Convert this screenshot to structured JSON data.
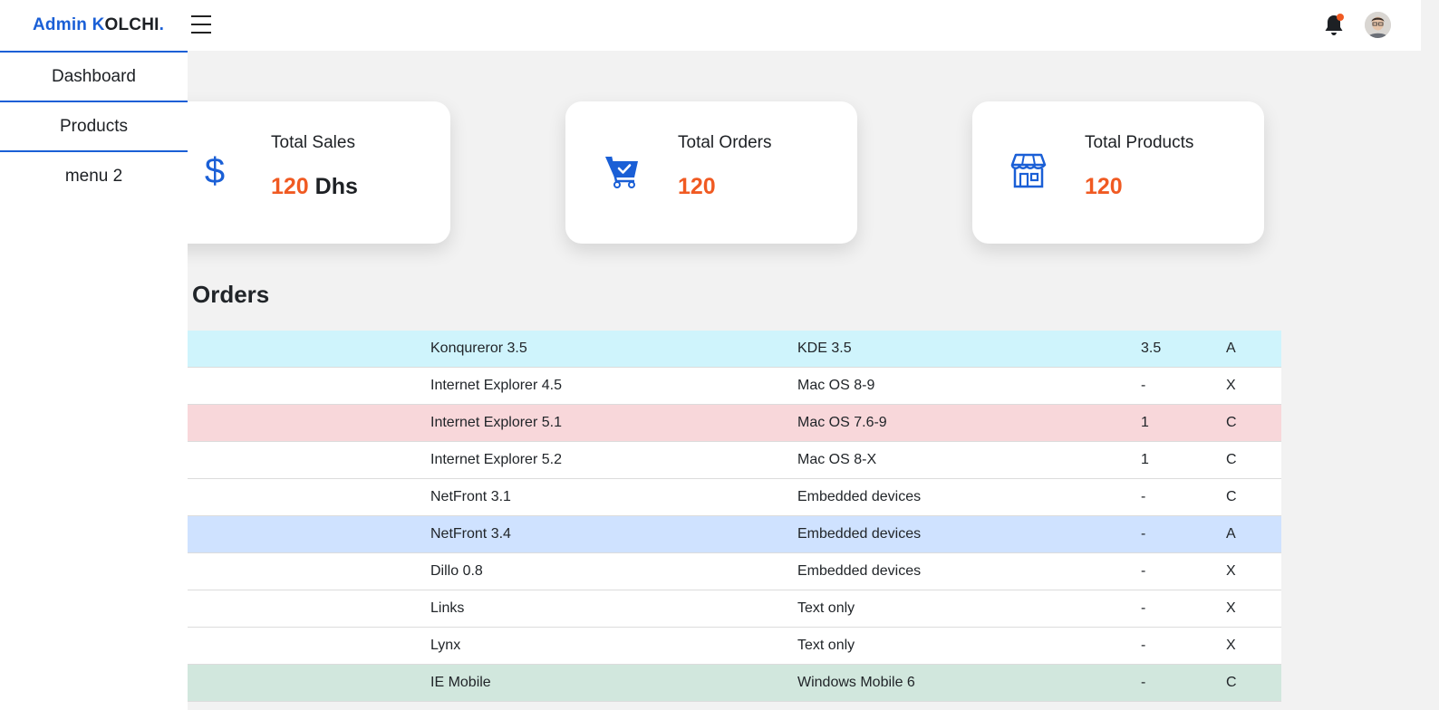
{
  "brand": {
    "part1": "Admin ",
    "part2": "K",
    "part3": "OLCHI",
    "part4": "."
  },
  "icons": {
    "menu": "hamburger-icon",
    "notifications": "bell-icon",
    "profile": "avatar"
  },
  "sidebar": {
    "items": [
      {
        "label": "Dashboard"
      },
      {
        "label": "Products"
      },
      {
        "label": "menu 2"
      }
    ]
  },
  "stats": {
    "sales": {
      "label": "Total Sales",
      "value": "120",
      "unit": " Dhs",
      "icon": "dollar-icon"
    },
    "orders": {
      "label": "Total Orders",
      "value": "120",
      "icon": "cart-icon"
    },
    "products": {
      "label": "Total Products",
      "value": "120",
      "icon": "store-icon"
    }
  },
  "orders": {
    "title": "Orders",
    "rows": [
      {
        "browser": "Konqureror 3.5",
        "platform": "KDE 3.5",
        "version": "3.5",
        "grade": "A"
      },
      {
        "browser": "Internet Explorer 4.5",
        "platform": "Mac OS 8-9",
        "version": "-",
        "grade": "X"
      },
      {
        "browser": "Internet Explorer 5.1",
        "platform": "Mac OS 7.6-9",
        "version": "1",
        "grade": "C"
      },
      {
        "browser": "Internet Explorer 5.2",
        "platform": "Mac OS 8-X",
        "version": "1",
        "grade": "C"
      },
      {
        "browser": "NetFront 3.1",
        "platform": "Embedded devices",
        "version": "-",
        "grade": "C"
      },
      {
        "browser": "NetFront 3.4",
        "platform": "Embedded devices",
        "version": "-",
        "grade": "A"
      },
      {
        "browser": "Dillo 0.8",
        "platform": "Embedded devices",
        "version": "-",
        "grade": "X"
      },
      {
        "browser": "Links",
        "platform": "Text only",
        "version": "-",
        "grade": "X"
      },
      {
        "browser": "Lynx",
        "platform": "Text only",
        "version": "-",
        "grade": "X"
      },
      {
        "browser": "IE Mobile",
        "platform": "Windows Mobile 6",
        "version": "-",
        "grade": "C"
      }
    ]
  },
  "colors": {
    "accent": "#1a5fd6",
    "highlight": "#f05a22",
    "row_info": "#cff4fc",
    "row_danger": "#f8d7da",
    "row_primary": "#cfe2ff",
    "row_success": "#d1e7dd"
  }
}
